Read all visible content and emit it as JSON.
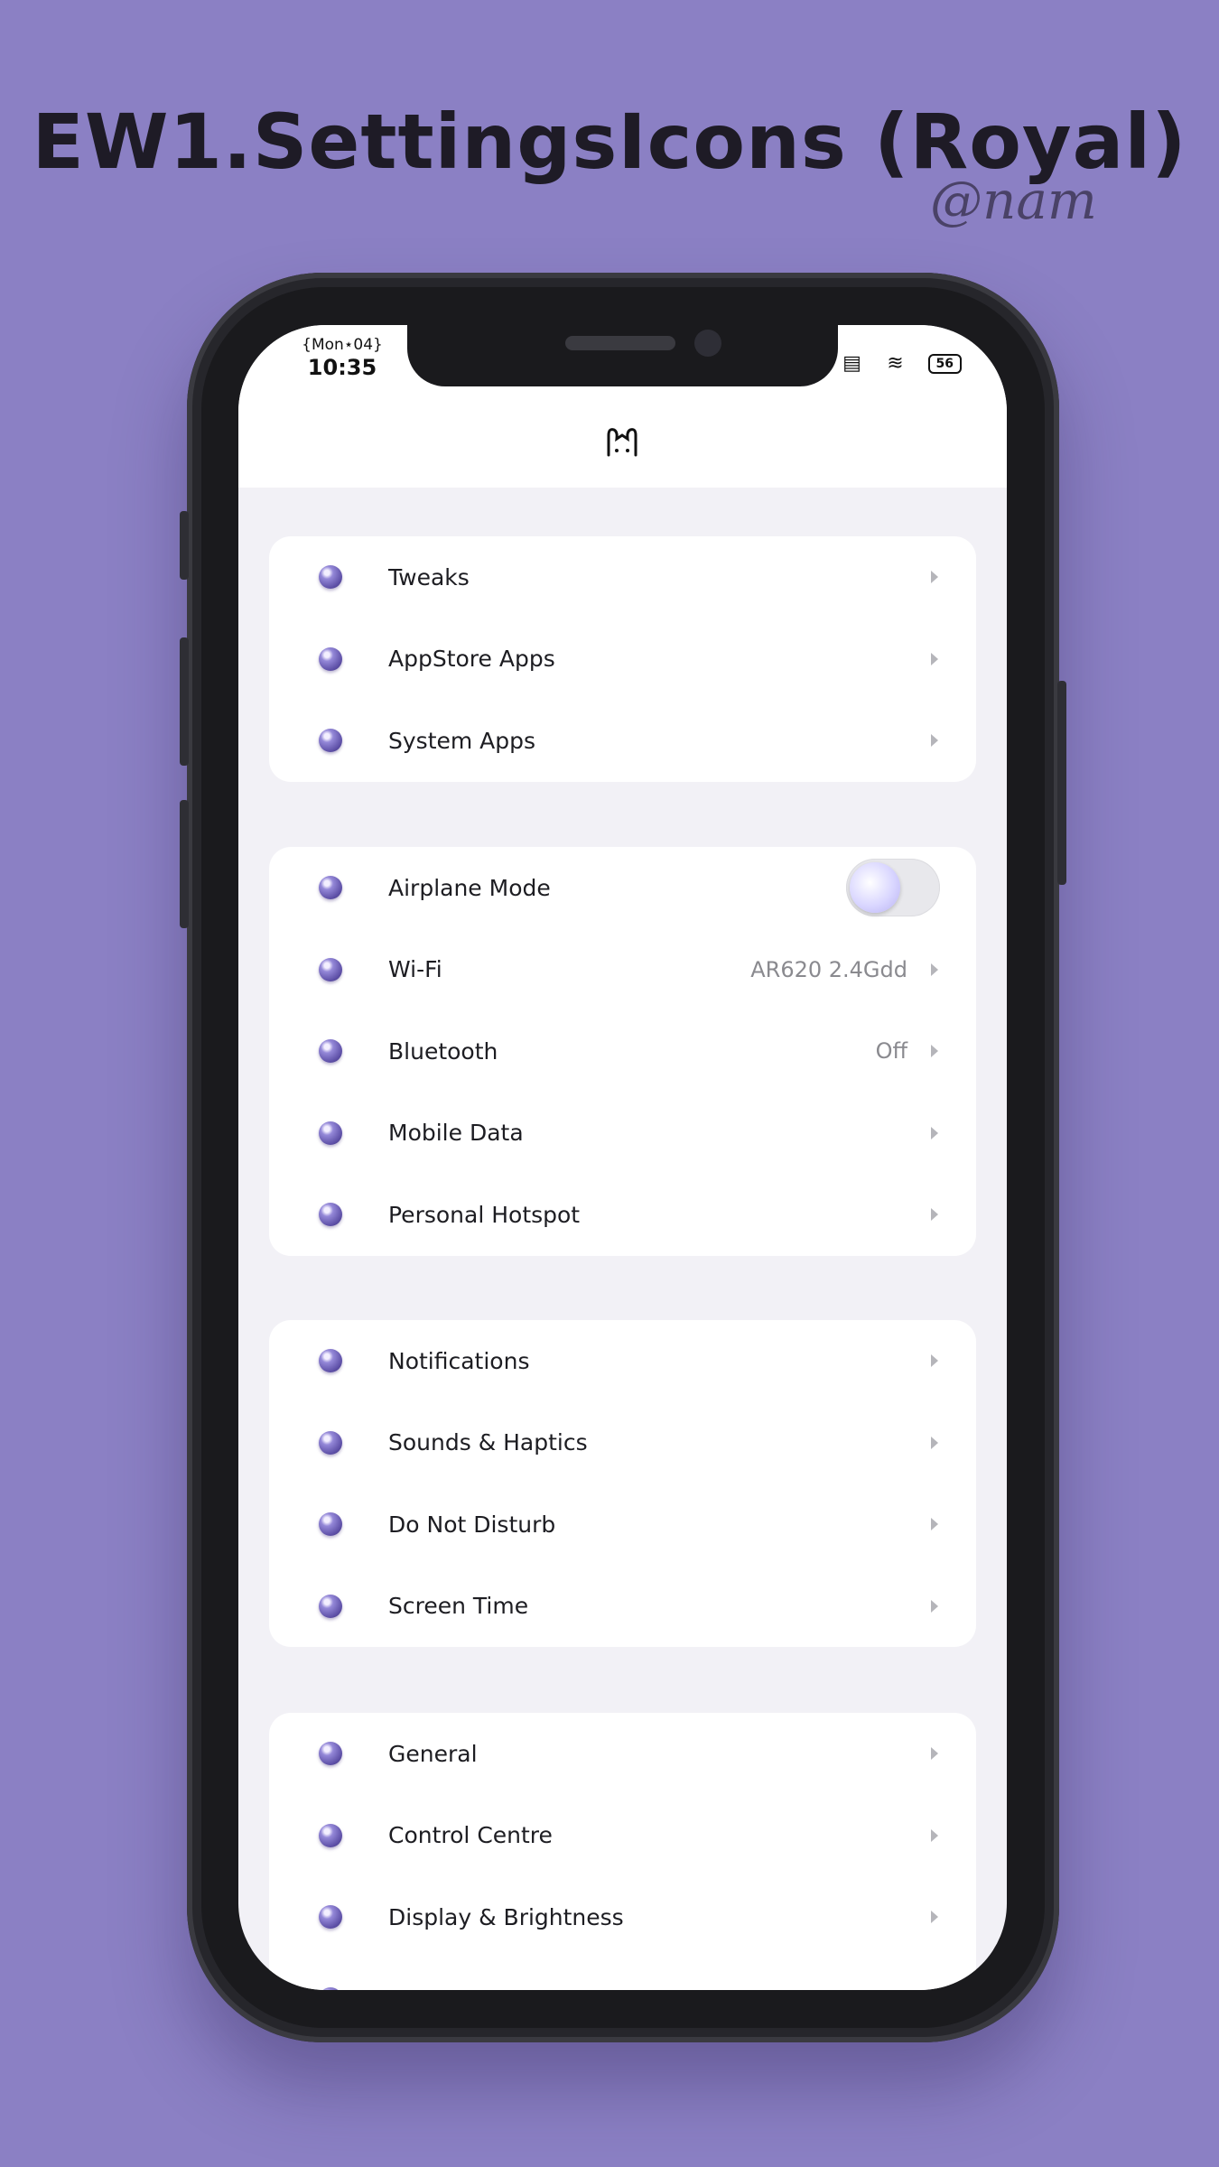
{
  "header": {
    "title": "EW1.SettingsIcons (Royal)",
    "signature": "@nam"
  },
  "status_bar": {
    "date": "{Mon⋆04}",
    "time": "10:35",
    "battery": "56"
  },
  "groups": [
    {
      "items": [
        {
          "label": "Tweaks",
          "value": ""
        },
        {
          "label": "AppStore Apps",
          "value": ""
        },
        {
          "label": "System Apps",
          "value": ""
        }
      ]
    },
    {
      "items": [
        {
          "label": "Airplane Mode",
          "toggle": true,
          "toggle_on": false
        },
        {
          "label": "Wi-Fi",
          "value": "AR620 2.4Gdd"
        },
        {
          "label": "Bluetooth",
          "value": "Off"
        },
        {
          "label": "Mobile Data",
          "value": ""
        },
        {
          "label": "Personal Hotspot",
          "value": ""
        }
      ]
    },
    {
      "items": [
        {
          "label": "Notifications",
          "value": ""
        },
        {
          "label": "Sounds & Haptics",
          "value": ""
        },
        {
          "label": "Do Not Disturb",
          "value": ""
        },
        {
          "label": "Screen Time",
          "value": ""
        }
      ]
    },
    {
      "items": [
        {
          "label": "General",
          "value": ""
        },
        {
          "label": "Control Centre",
          "value": ""
        },
        {
          "label": "Display & Brightness",
          "value": ""
        }
      ]
    }
  ],
  "colors": {
    "background": "#8b80c4",
    "icon_accent": "#5d4fa6"
  }
}
